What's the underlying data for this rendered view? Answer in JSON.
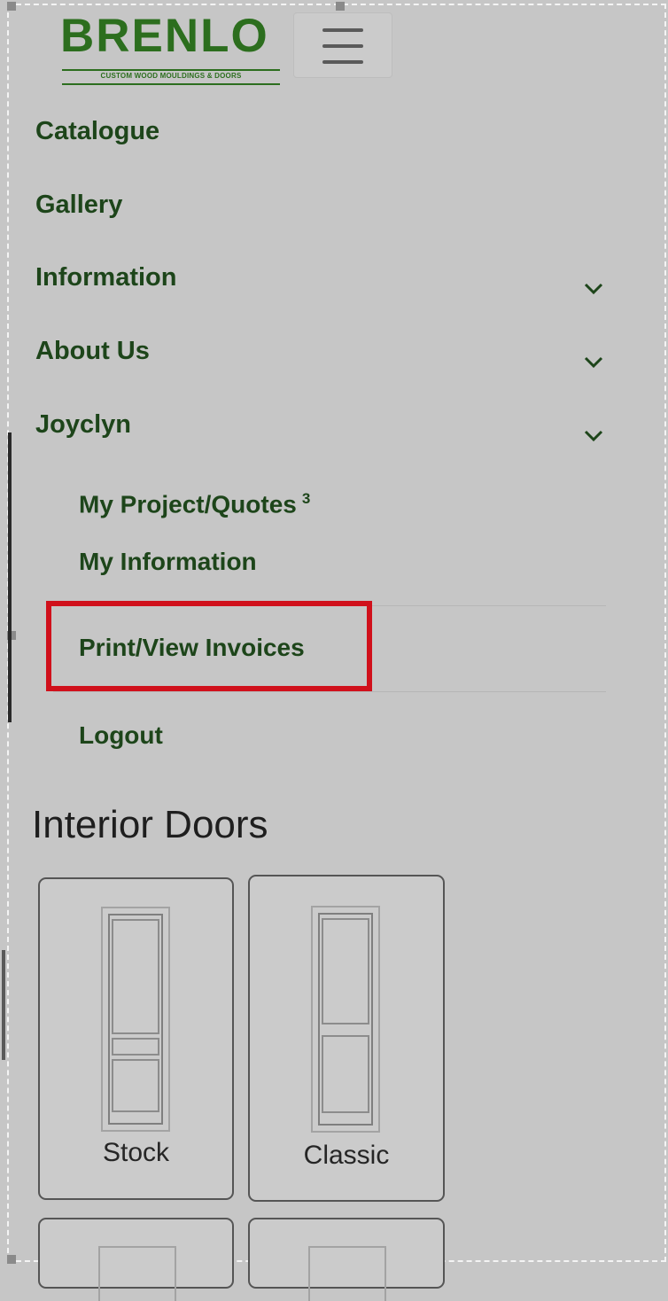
{
  "brand": {
    "name": "BRENLO",
    "tagline": "CUSTOM WOOD MOULDINGS & DOORS",
    "color": "#2c6e1e"
  },
  "header": {
    "menu_icon": "hamburger-menu-icon"
  },
  "nav": {
    "items": [
      {
        "label": "Catalogue",
        "has_dropdown": false
      },
      {
        "label": "Gallery",
        "has_dropdown": false
      },
      {
        "label": "Information",
        "has_dropdown": true
      },
      {
        "label": "About Us",
        "has_dropdown": true
      },
      {
        "label": "Joyclyn",
        "has_dropdown": true
      }
    ],
    "user_submenu": [
      {
        "label": "My Project/Quotes",
        "badge": "3"
      },
      {
        "label": "My Information"
      },
      {
        "label": "Print/View Invoices",
        "highlighted": true
      },
      {
        "label": "Logout"
      }
    ],
    "text_color": "#1d451a",
    "highlight_color": "#d0101b"
  },
  "section": {
    "title": "Interior Doors",
    "cards": [
      {
        "label": "Stock"
      },
      {
        "label": "Classic"
      }
    ]
  }
}
